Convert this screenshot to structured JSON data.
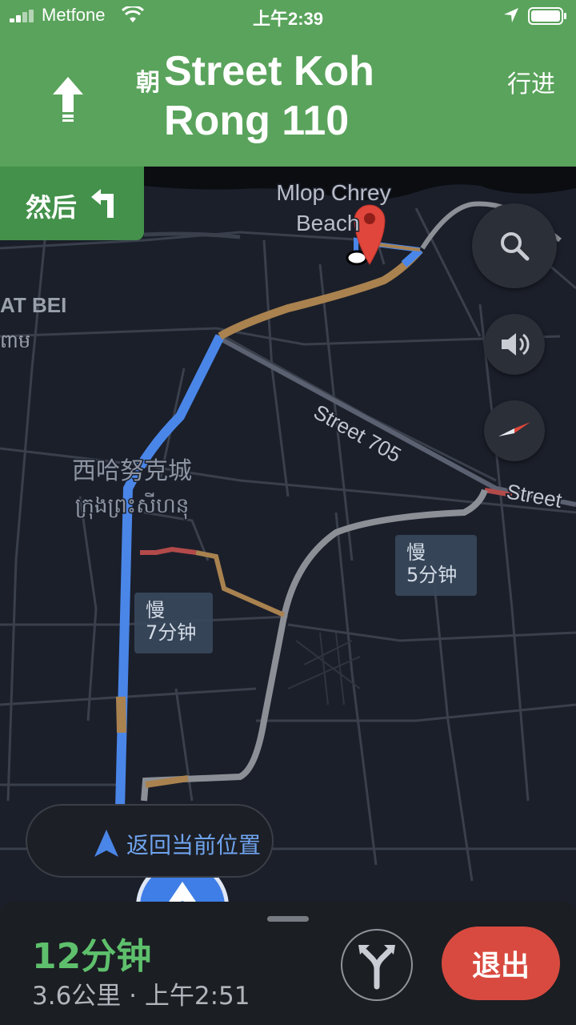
{
  "status_bar": {
    "carrier": "Metfone",
    "time": "上午2:39"
  },
  "banner": {
    "toward_prefix": "朝",
    "street_name": "Street Koh Rong 110",
    "overview_label": "行进",
    "then_label": "然后"
  },
  "map": {
    "labels": {
      "beach": "Mlop Chrey",
      "beach_2": "Beach",
      "area_left": "AT BEI",
      "area_left_khmer": "ពាម",
      "street_705": "Street 705",
      "street_right": "Street",
      "city_cn": "西哈努克城",
      "city_khmer": "ក្រុងព្រះសីហនុ"
    }
  },
  "traffic": [
    {
      "status": "慢",
      "time": "7分钟"
    },
    {
      "status": "慢",
      "time": "5分钟"
    }
  ],
  "recenter_label": "返回当前位置",
  "trip": {
    "eta_duration": "12分钟",
    "details": "3.6公里 · 上午2:51"
  },
  "exit_label": "退出",
  "colors": {
    "banner_green": "#5aa35c",
    "route_blue": "#4a86e8",
    "traffic_slow": "#a9824f",
    "exit_red": "#d84a3f",
    "eta_green": "#5ec06c"
  }
}
